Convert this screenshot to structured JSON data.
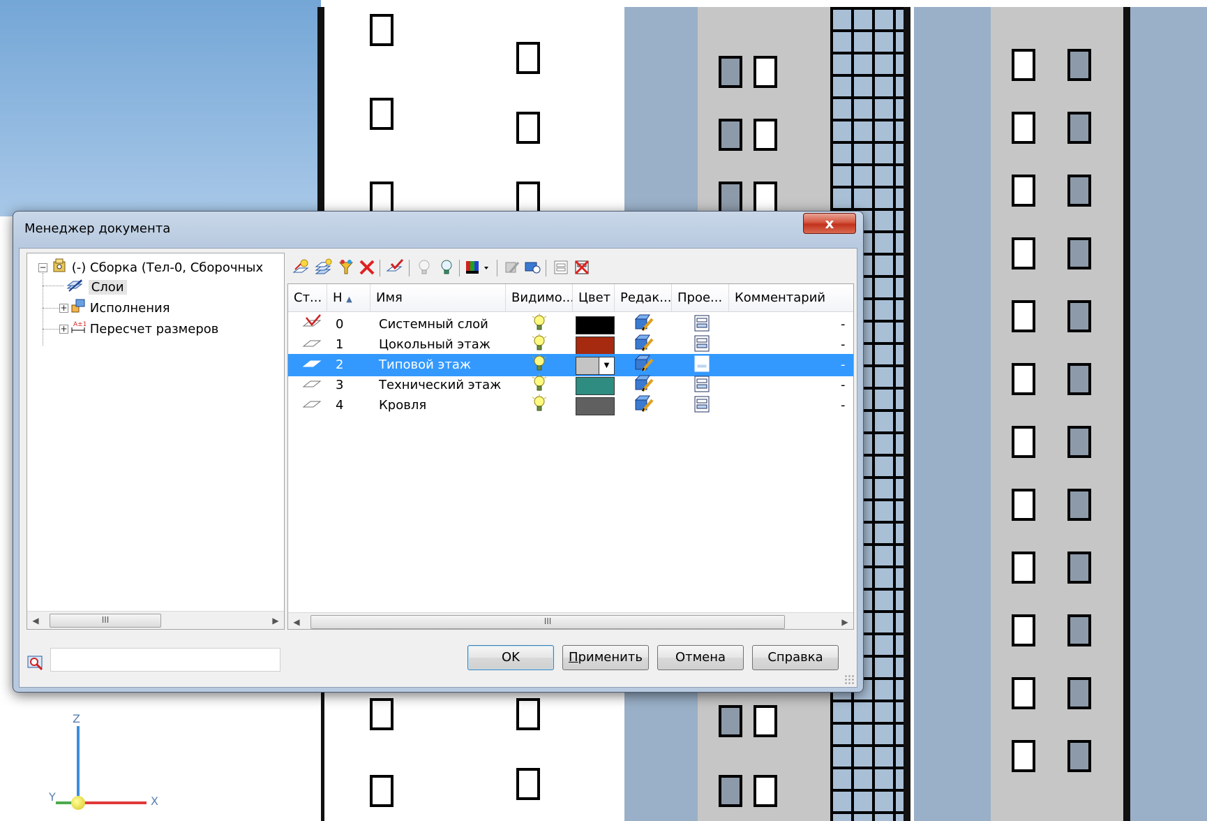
{
  "dialog": {
    "title": "Менеджер документа",
    "close_label": "x"
  },
  "tree": {
    "root": "(-) Сборка (Тел-0, Сборочных",
    "items": [
      {
        "label": "Слои"
      },
      {
        "label": "Исполнения"
      },
      {
        "label": "Пересчет размеров"
      }
    ],
    "scroll_label": "III"
  },
  "toolbar": {
    "icons": [
      "new-layer-icon",
      "new-layers-icon",
      "filter-icon",
      "delete-icon",
      "set-current-icon",
      "hide-icon",
      "show-icon",
      "color-icon",
      "edit-off-icon",
      "edit-on-icon",
      "print-icon",
      "no-print-icon"
    ]
  },
  "table": {
    "columns": [
      "Ст...",
      "Н",
      "Имя",
      "Видимо...",
      "Цвет",
      "Редак...",
      "Прое...",
      "Комментарий"
    ],
    "rows": [
      {
        "num": "0",
        "name": "Системный слой",
        "color": "#000000",
        "comment": "-"
      },
      {
        "num": "1",
        "name": "Цокольный этаж",
        "color": "#a52a10",
        "comment": "-"
      },
      {
        "num": "2",
        "name": "Типовой этаж",
        "color": "#c4c4c4",
        "comment": "-",
        "selected": true
      },
      {
        "num": "3",
        "name": "Технический этаж",
        "color": "#2e8c80",
        "comment": "-"
      },
      {
        "num": "4",
        "name": "Кровля",
        "color": "#606060",
        "comment": "-"
      }
    ],
    "scroll_label": "III",
    "selection_color": "#3399ff"
  },
  "search": {
    "value": ""
  },
  "buttons": {
    "ok": "OK",
    "apply_first": "П",
    "apply_rest": "рименить",
    "cancel": "Отмена",
    "help": "Справка"
  },
  "axis": {
    "z": "Z",
    "y": "Y",
    "x": "X"
  }
}
